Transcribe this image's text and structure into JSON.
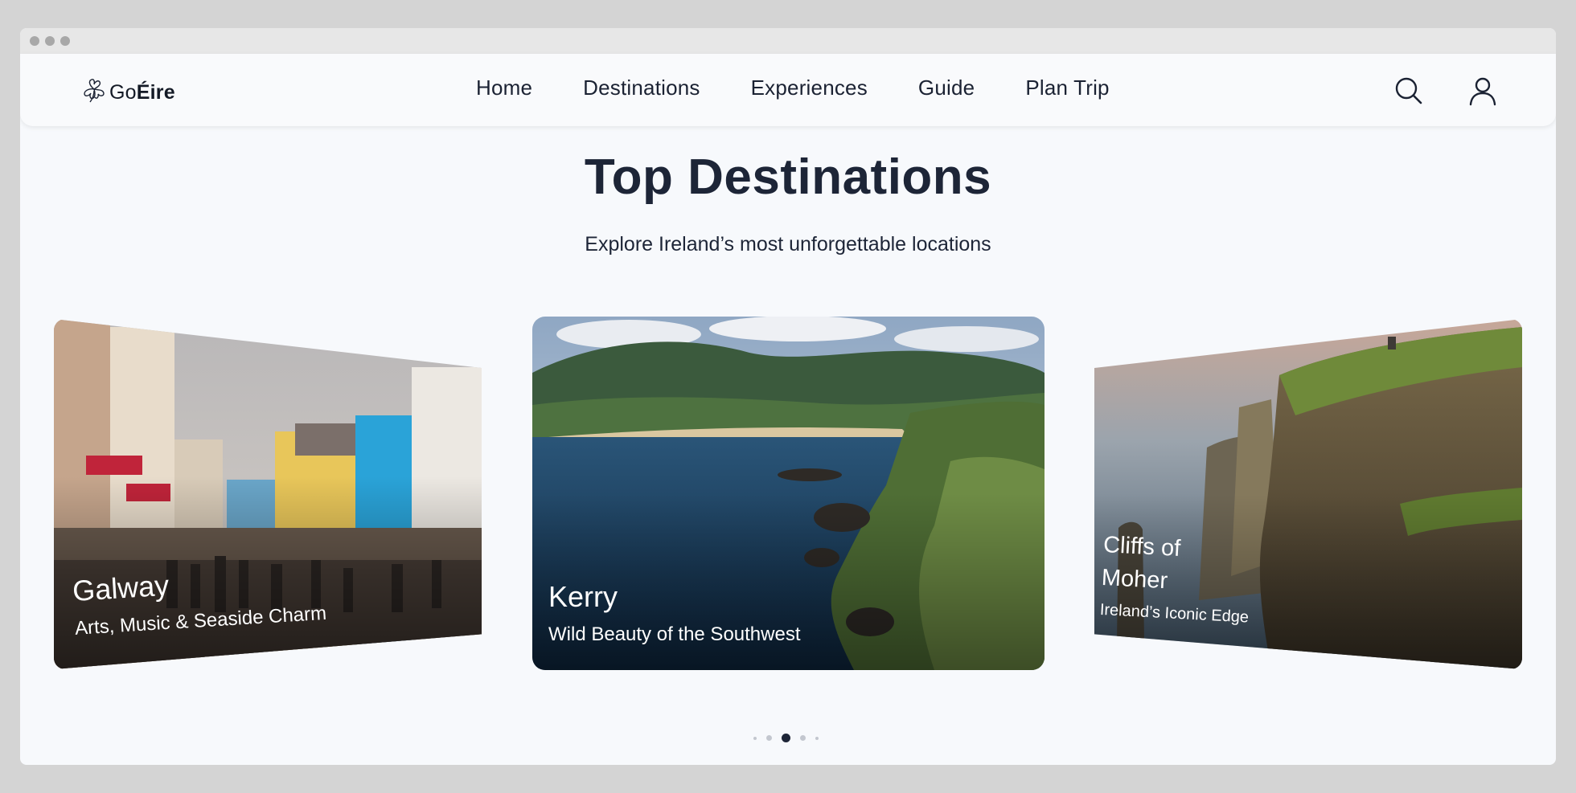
{
  "window": {
    "controls": [
      "close-dot",
      "minimize-dot",
      "maximize-dot"
    ]
  },
  "brand": {
    "prefix": "Go",
    "suffix": "Éire",
    "icon": "shamrock-icon"
  },
  "nav": {
    "items": [
      {
        "label": "Home"
      },
      {
        "label": "Destinations"
      },
      {
        "label": "Experiences"
      },
      {
        "label": "Guide"
      },
      {
        "label": "Plan Trip"
      }
    ],
    "icons": [
      "search-icon",
      "user-icon"
    ]
  },
  "hero": {
    "title": "Top Destinations",
    "subtitle": "Explore Ireland’s most unforgettable locations"
  },
  "carousel": {
    "cards": [
      {
        "title": "Galway",
        "subtitle": "Arts, Music & Seaside Charm",
        "position": "left"
      },
      {
        "title": "Kerry",
        "subtitle": "Wild Beauty of the Southwest",
        "position": "center"
      },
      {
        "title": "Cliffs of",
        "title2": "Moher",
        "subtitle": "Ireland’s Iconic Edge",
        "position": "right"
      }
    ],
    "active_index": 2,
    "dot_count": 5
  },
  "colors": {
    "background": "#f7f9fc",
    "heading": "#1d2537",
    "active_dot": "#1d2537",
    "inactive_dot": "#c3c7cf"
  }
}
